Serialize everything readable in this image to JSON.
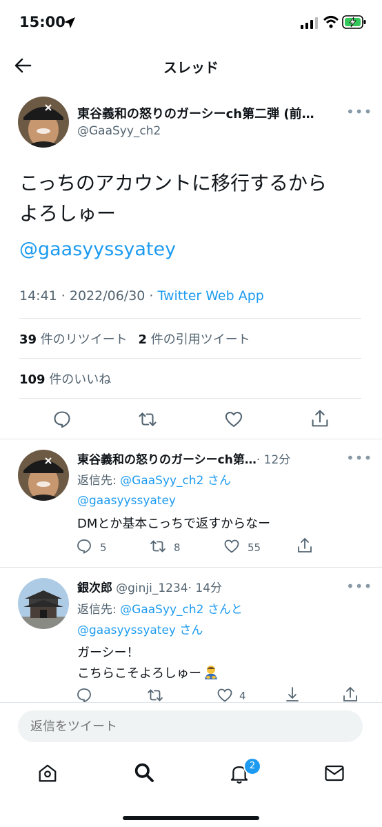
{
  "status_bar": {
    "time": "15:00"
  },
  "nav": {
    "title": "スレッド"
  },
  "main_tweet": {
    "name": "東谷義和の怒りのガーシーch第二弾 (前…",
    "handle": "@GaaSyy_ch2",
    "text_line1": "こっちのアカウントに移行するから",
    "text_line2": "よろしゅー",
    "mention": "@gaasyyssyatey",
    "time": "14:41 · 2022/06/30 · ",
    "source": "Twitter Web App",
    "retweets_count": "39",
    "retweets_label": "件のリツイート",
    "quotes_count": "2",
    "quotes_label": "件の引用ツイート",
    "likes_count": "109",
    "likes_label": "件のいいね"
  },
  "reply1": {
    "name": "東谷義和の怒りのガーシーch第…",
    "meta": "· 12分",
    "reply_to_label": "返信先: ",
    "reply_to_handle": "@GaaSyy_ch2",
    "reply_to_suffix": " さん",
    "mention": "@gaasyyssyatey",
    "text": "DMとか基本こっちで返すからなー",
    "replies": "5",
    "retweets": "8",
    "likes": "55"
  },
  "reply2": {
    "name": "銀次郎",
    "handle": "@ginji_1234",
    "meta": "· 14分",
    "reply_to_label": "返信先: ",
    "reply_to_handle": "@GaaSyy_ch2",
    "reply_to_mid": " さんと",
    "reply_to_handle2": "@gaasyyssyatey",
    "reply_to_suffix": " さん",
    "text_line1": "ガーシー！",
    "text_line2": "こちらこそよろしゅー",
    "likes": "4"
  },
  "compose": {
    "placeholder": "返信をツイート"
  },
  "tabbar": {
    "notifications_badge": "2"
  }
}
